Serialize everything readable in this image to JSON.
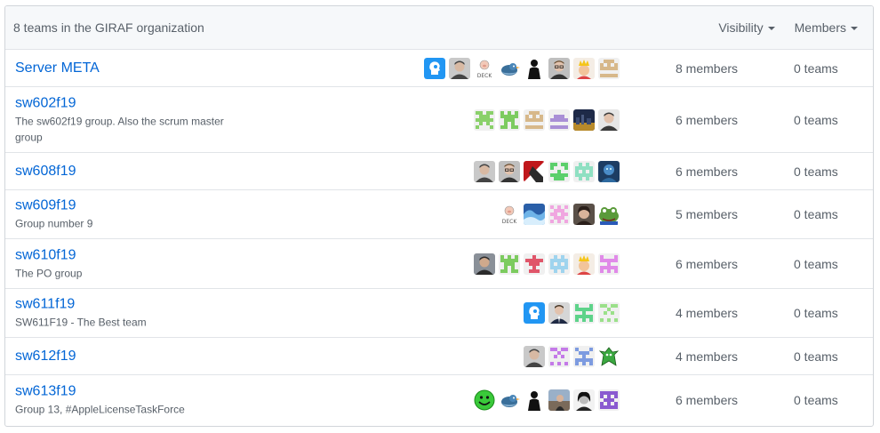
{
  "header": {
    "title": "8 teams in the GIRAF organization",
    "visibility_label": "Visibility",
    "members_label": "Members"
  },
  "teams": [
    {
      "name": "Server META",
      "description": "",
      "members": "8 members",
      "teams": "0 teams",
      "avatars": [
        "blue-face",
        "photo-gray",
        "pig-logo",
        "bird",
        "silhouette",
        "photo-glasses",
        "crown",
        "identicon-tan"
      ]
    },
    {
      "name": "sw602f19",
      "description": "The sw602f19 group. Also the scrum master group",
      "members": "6 members",
      "teams": "0 teams",
      "avatars": [
        "identicon-green",
        "identicon-green2",
        "identicon-tan",
        "identicon-purple",
        "photo-city",
        "photo-man"
      ]
    },
    {
      "name": "sw608f19",
      "description": "",
      "members": "6 members",
      "teams": "0 teams",
      "avatars": [
        "photo-gray",
        "photo-glasses",
        "red-logo",
        "identicon-green3",
        "identicon-mint",
        "photo-blue"
      ]
    },
    {
      "name": "sw609f19",
      "description": "Group number 9",
      "members": "5 members",
      "teams": "0 teams",
      "avatars": [
        "pig-logo",
        "photo-blue2",
        "identicon-pink",
        "photo-woman",
        "frog"
      ]
    },
    {
      "name": "sw610f19",
      "description": "The PO group",
      "members": "6 members",
      "teams": "0 teams",
      "avatars": [
        "photo-man2",
        "identicon-green2",
        "identicon-red",
        "identicon-sky",
        "crown",
        "identicon-magenta"
      ]
    },
    {
      "name": "sw611f19",
      "description": "SW611F19 - The Best team",
      "members": "4 members",
      "teams": "0 teams",
      "avatars": [
        "blue-face",
        "photo-suit",
        "identicon-green4",
        "identicon-lime"
      ]
    },
    {
      "name": "sw612f19",
      "description": "",
      "members": "4 members",
      "teams": "0 teams",
      "avatars": [
        "photo-gray",
        "identicon-violet",
        "identicon-blue",
        "cartoon-green"
      ]
    },
    {
      "name": "sw613f19",
      "description": "Group 13, #AppleLicenseTaskForce",
      "members": "6 members",
      "teams": "0 teams",
      "avatars": [
        "smiley",
        "bird",
        "silhouette",
        "photo-street",
        "photo-bw",
        "identicon-purple2"
      ]
    }
  ],
  "colors": {
    "link": "#0366d6",
    "muted": "#586069",
    "header_bg": "#f6f8fa",
    "border": "#e1e4e8"
  }
}
